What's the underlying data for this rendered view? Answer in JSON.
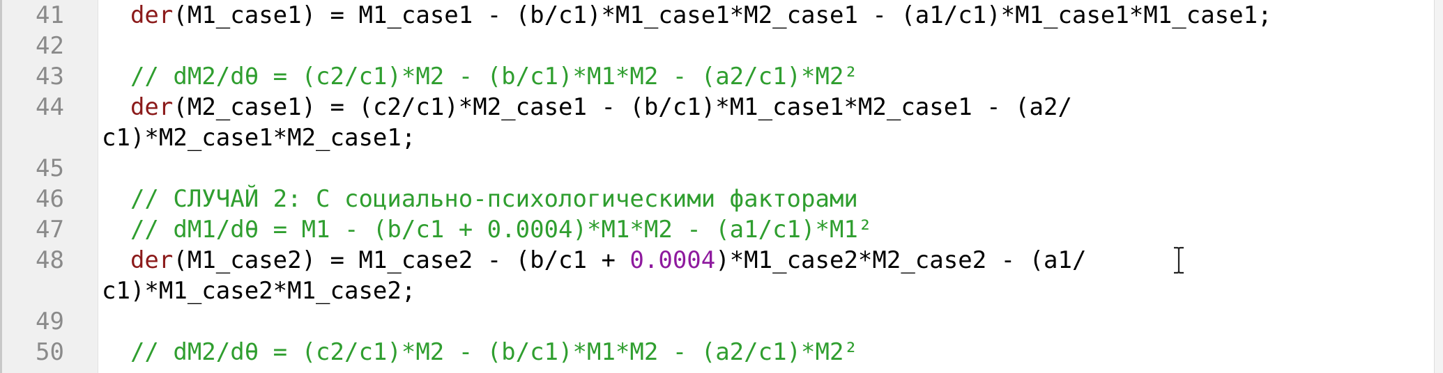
{
  "editor": {
    "lines": [
      {
        "num": "41",
        "parts": [
          {
            "t": "  "
          },
          {
            "t": "der",
            "c": "kw"
          },
          {
            "t": "(M1_case1) = M1_case1 - (b/c1)*M1_case1*M2_case1 - (a1/c1)*M1_case1*M1_case1;"
          }
        ]
      },
      {
        "num": "42",
        "parts": []
      },
      {
        "num": "43",
        "parts": [
          {
            "t": "  // dM2/dθ = (c2/c1)*M2 - (b/c1)*M1*M2 - (a2/c1)*M2²",
            "c": "cm"
          }
        ]
      },
      {
        "num": "44",
        "parts": [
          {
            "t": "  "
          },
          {
            "t": "der",
            "c": "kw"
          },
          {
            "t": "(M2_case1) = (c2/c1)*M2_case1 - (b/c1)*M1_case1*M2_case1 - (a2/"
          }
        ],
        "cont": "c1)*M2_case1*M2_case1;"
      },
      {
        "num": "45",
        "parts": []
      },
      {
        "num": "46",
        "parts": [
          {
            "t": "  // СЛУЧАЙ 2: С социально-психологическими факторами",
            "c": "cm"
          }
        ]
      },
      {
        "num": "47",
        "parts": [
          {
            "t": "  // dM1/dθ = M1 - (b/c1 + 0.0004)*M1*M2 - (a1/c1)*M1²",
            "c": "cm"
          }
        ]
      },
      {
        "num": "48",
        "parts": [
          {
            "t": "  "
          },
          {
            "t": "der",
            "c": "kw"
          },
          {
            "t": "(M1_case2) = M1_case2 - (b/c1 + "
          },
          {
            "t": "0.0004",
            "c": "num"
          },
          {
            "t": ")*M1_case2*M2_case2 - (a1/"
          }
        ],
        "cont": "c1)*M1_case2*M1_case2;"
      },
      {
        "num": "49",
        "parts": []
      },
      {
        "num": "50",
        "parts": [
          {
            "t": "  // dM2/dθ = (c2/c1)*M2 - (b/c1)*M1*M2 - (a2/c1)*M2²",
            "c": "cm"
          }
        ]
      }
    ]
  },
  "icons": {
    "cursor": "text-cursor-ibeam-icon"
  },
  "colors": {
    "keyword": "#8b1a1a",
    "comment": "#2f9e2f",
    "number": "#8e1a9e",
    "line_number": "#8a8a8a"
  }
}
